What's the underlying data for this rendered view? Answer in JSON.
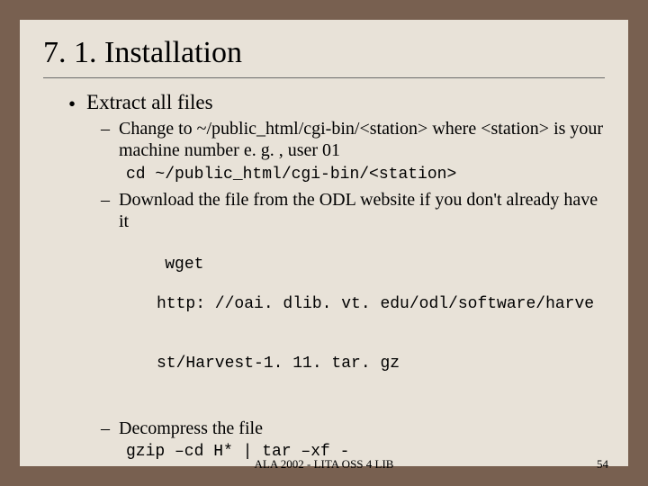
{
  "title": "7. 1. Installation",
  "bullet1": "Extract all files",
  "sub1": "Change to  ~/public_html/cgi-bin/<station> where <station> is your machine number e. g. , user 01",
  "code1": "cd ~/public_html/cgi-bin/<station>",
  "sub2": "Download the file from the ODL website if you don't already have it",
  "code2a": "wget",
  "code2b": "http: //oai. dlib. vt. edu/odl/software/harve",
  "code2c": "st/Harvest-1. 11. tar. gz",
  "sub3": "Decompress the file",
  "code3": "gzip –cd H* | tar –xf -",
  "footer_center": "ALA 2002 - LITA OSS 4 LIB",
  "footer_right": "54"
}
